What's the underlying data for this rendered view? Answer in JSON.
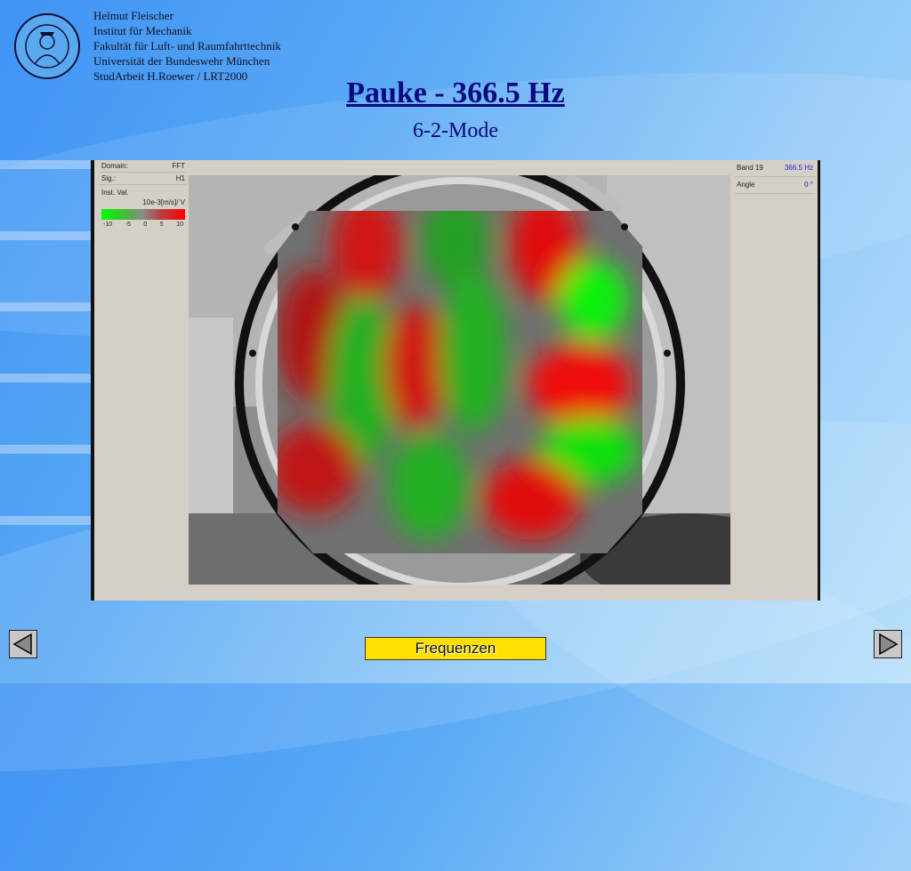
{
  "header": {
    "author_lines": [
      "Helmut Fleischer",
      "Institut für Mechanik",
      "Fakultät für Luft- und Raumfahrttechnik",
      "Universität der Bundeswehr München",
      "StudArbeit H.Roewer / LRT2000"
    ],
    "title": "Pauke - 366.5 Hz",
    "subtitle": "6-2-Mode"
  },
  "viewer": {
    "left_panel": {
      "domain_label": "Domain:",
      "domain_value": "FFT",
      "sig_label": "Sig.:",
      "sig_value": "H1",
      "inst_label": "Inst. Val.",
      "unit": "10e-3[m/s]/ V",
      "scale_ticks": [
        "-10",
        "-5",
        "0",
        "5",
        "10"
      ]
    },
    "right_panel": {
      "band_label": "Band 19",
      "band_value": "366.5 Hz",
      "angle_label": "Angle",
      "angle_value": "0 °"
    }
  },
  "footer": {
    "center_button": "Frequenzen"
  },
  "colors": {
    "title": "#0a0a80",
    "button": "#ffe000",
    "positive": "#ff0000",
    "negative": "#00ff00"
  }
}
